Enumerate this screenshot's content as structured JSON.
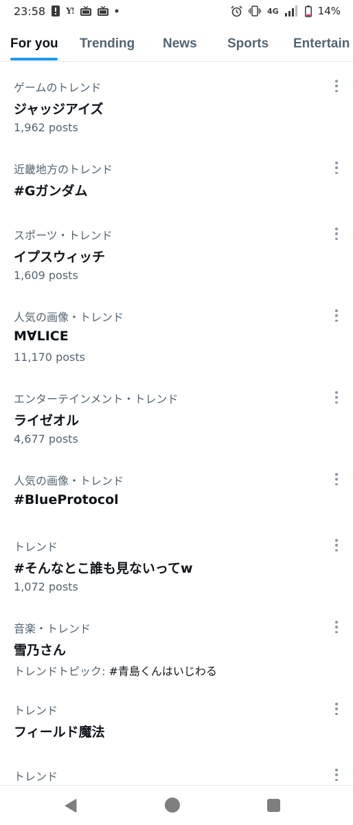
{
  "status_bar": {
    "time": "23:58",
    "network": "4G",
    "battery": "14%",
    "icons_left": [
      "alert-icon",
      "yahoo-icon",
      "tv-icon",
      "tv-icon",
      "dot-icon"
    ],
    "icons_right": [
      "alarm-icon",
      "vibrate-icon",
      "signal-icon",
      "battery-icon"
    ],
    "yahoo_label": "Y!"
  },
  "tabs": [
    {
      "label": "For you",
      "active": true
    },
    {
      "label": "Trending",
      "active": false
    },
    {
      "label": "News",
      "active": false
    },
    {
      "label": "Sports",
      "active": false
    },
    {
      "label": "Entertain",
      "active": false
    }
  ],
  "accent_color": "#1d9bf0",
  "trends": [
    {
      "category": "ゲームのトレンド",
      "title": "ジャッジアイズ",
      "posts": "1,962 posts"
    },
    {
      "category": "近畿地方のトレンド",
      "title": "#Gガンダム",
      "posts": ""
    },
    {
      "category": "スポーツ・トレンド",
      "title": "イプスウィッチ",
      "posts": "1,609 posts"
    },
    {
      "category": "人気の画像・トレンド",
      "title": "M∀LICE",
      "posts": "11,170 posts"
    },
    {
      "category": "エンターテインメント・トレンド",
      "title": "ライゼオル",
      "posts": "4,677 posts"
    },
    {
      "category": "人気の画像・トレンド",
      "title": "#BlueProtocol",
      "posts": ""
    },
    {
      "category": "トレンド",
      "title": "#そんなとこ誰も見ないってw",
      "posts": "1,072 posts"
    },
    {
      "category": "音楽・トレンド",
      "title": "雪乃さん",
      "topic_label": "トレンドトピック:",
      "topic_tag": "#青島くんはいじわる"
    },
    {
      "category": "トレンド",
      "title": "フィールド魔法",
      "posts": ""
    },
    {
      "category": "トレンド",
      "title": "",
      "posts": ""
    }
  ],
  "nav": {
    "back": "back-icon",
    "home": "home-icon",
    "recents": "recents-icon"
  }
}
